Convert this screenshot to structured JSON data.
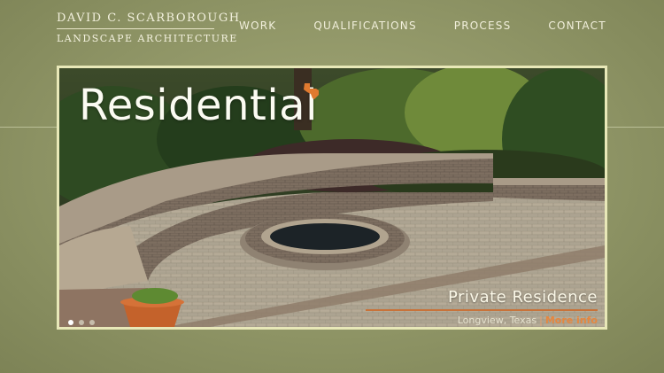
{
  "logo": {
    "line1": "DAVID C. SCARBOROUGH",
    "line2": "LANDSCAPE ARCHITECTURE"
  },
  "nav": [
    {
      "label": "WORK"
    },
    {
      "label": "QUALIFICATIONS"
    },
    {
      "label": "PROCESS"
    },
    {
      "label": "CONTACT"
    }
  ],
  "hero": {
    "title": "Residential",
    "project_name": "Private Residence",
    "location": "Longview, Texas",
    "more_link": "More info",
    "slides_total": 3,
    "slide_active": 1,
    "accent_color": "#e07a2f"
  },
  "icons": {
    "state": "texas-icon"
  }
}
